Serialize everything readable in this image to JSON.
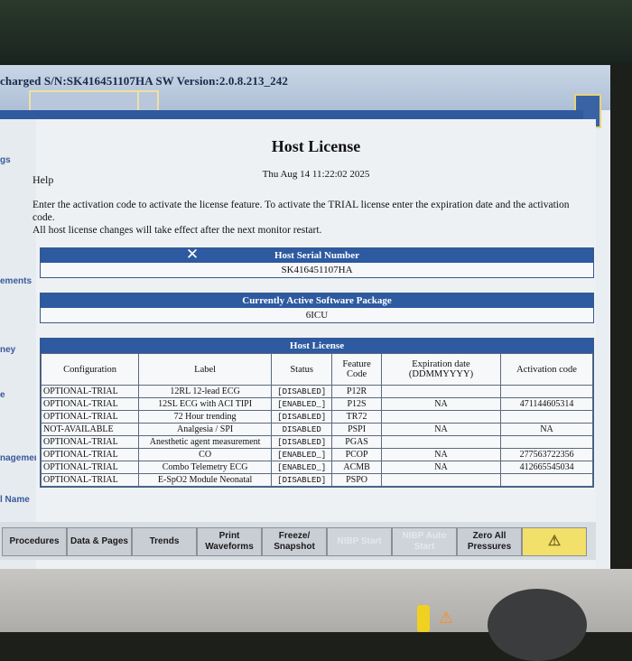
{
  "status_bar": {
    "text": "charged  S/N:SK416451107HA  SW Version:2.0.8.213_242"
  },
  "left_nav": [
    "gs",
    "ements",
    "ney",
    "e",
    "nagement",
    "l Name"
  ],
  "page": {
    "title": "Host License",
    "datetime": "Thu Aug 14 11:22:02 2025",
    "help": "Help",
    "instructions": [
      "Enter the activation code to activate the license feature. To activate the TRIAL license enter the expiration date and the activation code.",
      "All host license changes will take effect after the next monitor restart."
    ]
  },
  "host_serial": {
    "header": "Host Serial Number",
    "value": "SK416451107HA"
  },
  "software_package": {
    "header": "Currently Active Software Package",
    "value": "6ICU"
  },
  "license_table": {
    "header": "Host License",
    "columns": [
      "Configuration",
      "Label",
      "Status",
      "Feature Code",
      "Expiration date (DDMMYYYY)",
      "Activation code"
    ],
    "rows": [
      [
        "OPTIONAL-TRIAL",
        "12RL 12-lead ECG",
        "[DISABLED]",
        "P12R",
        "",
        ""
      ],
      [
        "OPTIONAL-TRIAL",
        "12SL ECG with ACI TIPI",
        "[ENABLED_]",
        "P12S",
        "NA",
        "471144605314"
      ],
      [
        "OPTIONAL-TRIAL",
        "72 Hour trending",
        "[DISABLED]",
        "TR72",
        "",
        ""
      ],
      [
        "NOT-AVAILABLE",
        "Analgesia / SPI",
        "DISABLED",
        "PSPI",
        "NA",
        "NA"
      ],
      [
        "OPTIONAL-TRIAL",
        "Anesthetic agent measurement",
        "[DISABLED]",
        "PGAS",
        "",
        ""
      ],
      [
        "OPTIONAL-TRIAL",
        "CO",
        "[ENABLED_]",
        "PCOP",
        "NA",
        "277563722356"
      ],
      [
        "OPTIONAL-TRIAL",
        "Combo Telemetry ECG",
        "[ENABLED_]",
        "ACMB",
        "NA",
        "412665545034"
      ],
      [
        "OPTIONAL-TRIAL",
        "E-SpO2 Module Neonatal",
        "[DISABLED]",
        "PSPO",
        "",
        ""
      ]
    ]
  },
  "bottom_buttons": [
    {
      "label": "Procedures",
      "enabled": true
    },
    {
      "label": "Data & Pages",
      "enabled": true
    },
    {
      "label": "Trends",
      "enabled": true
    },
    {
      "label": "Print Waveforms",
      "enabled": true
    },
    {
      "label": "Freeze/ Snapshot",
      "enabled": true
    },
    {
      "label": "NIBP Start",
      "enabled": false
    },
    {
      "label": "NIBP Auto Start",
      "enabled": false
    },
    {
      "label": "Zero All Pressures",
      "enabled": true
    }
  ],
  "colors": {
    "header_blue": "#2d5aa0",
    "alarm_yellow": "#f3e06a"
  }
}
